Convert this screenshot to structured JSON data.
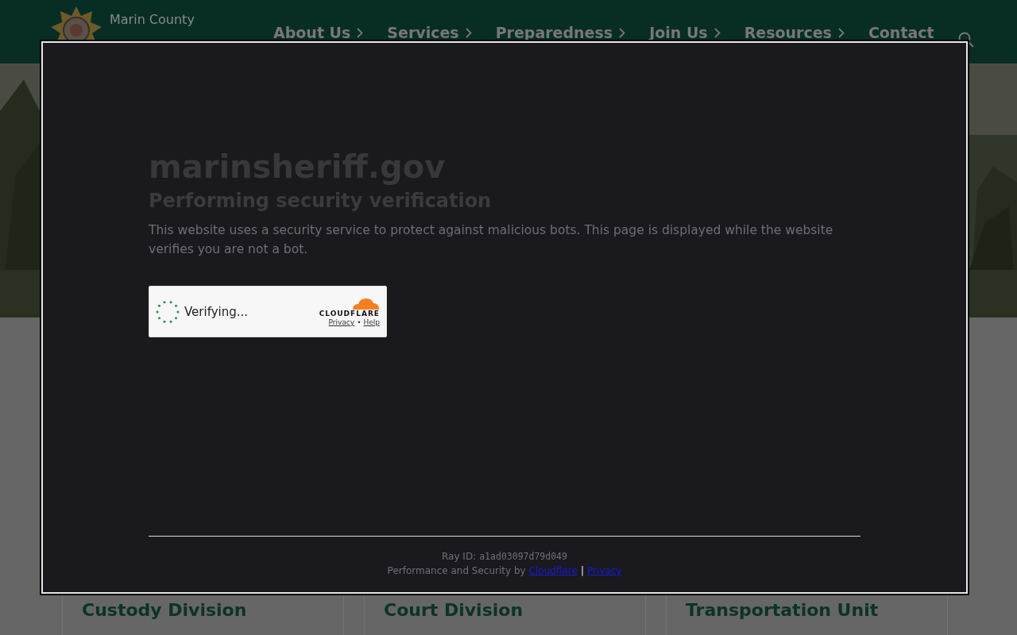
{
  "header": {
    "logo_line1": "Marin County",
    "nav": [
      {
        "label": "About Us",
        "has_submenu": true
      },
      {
        "label": "Services",
        "has_submenu": true
      },
      {
        "label": "Preparedness",
        "has_submenu": true
      },
      {
        "label": "Join Us",
        "has_submenu": true
      },
      {
        "label": "Resources",
        "has_submenu": true
      },
      {
        "label": "Contact",
        "has_submenu": false
      }
    ]
  },
  "cards": [
    {
      "title": "Custody Division"
    },
    {
      "title": "Court Division"
    },
    {
      "title": "Transportation Unit"
    }
  ],
  "modal": {
    "site": "marinsheriff.gov",
    "heading": "Performing security verification",
    "description": "This website uses a security service to protect against malicious bots. This page is displayed while the website verifies you are not a bot.",
    "widget": {
      "status": "Verifying...",
      "brand": "CLOUDFLARE",
      "links": [
        "Privacy",
        "Help"
      ],
      "link_separator": "•"
    },
    "ray_id_label": "Ray ID:",
    "ray_id": "a1ad03097d79d049",
    "footer_text": "Performance and Security by",
    "footer_links": [
      "Cloudflare",
      "Privacy"
    ],
    "footer_separator": "|"
  }
}
